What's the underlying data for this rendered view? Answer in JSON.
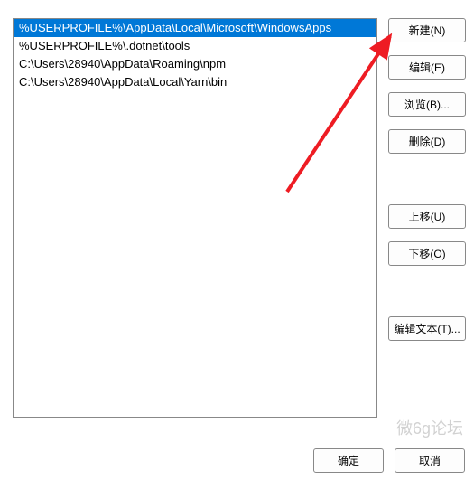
{
  "list": {
    "items": [
      "%USERPROFILE%\\AppData\\Local\\Microsoft\\WindowsApps",
      "%USERPROFILE%\\.dotnet\\tools",
      "C:\\Users\\28940\\AppData\\Roaming\\npm",
      "C:\\Users\\28940\\AppData\\Local\\Yarn\\bin"
    ],
    "selected_index": 0
  },
  "buttons": {
    "new": "新建(N)",
    "edit": "编辑(E)",
    "browse": "浏览(B)...",
    "delete": "删除(D)",
    "move_up": "上移(U)",
    "move_down": "下移(O)",
    "edit_text": "编辑文本(T)...",
    "ok": "确定",
    "cancel": "取消"
  },
  "watermark": "微6g论坛",
  "arrow": {
    "color": "#ee1c23"
  }
}
